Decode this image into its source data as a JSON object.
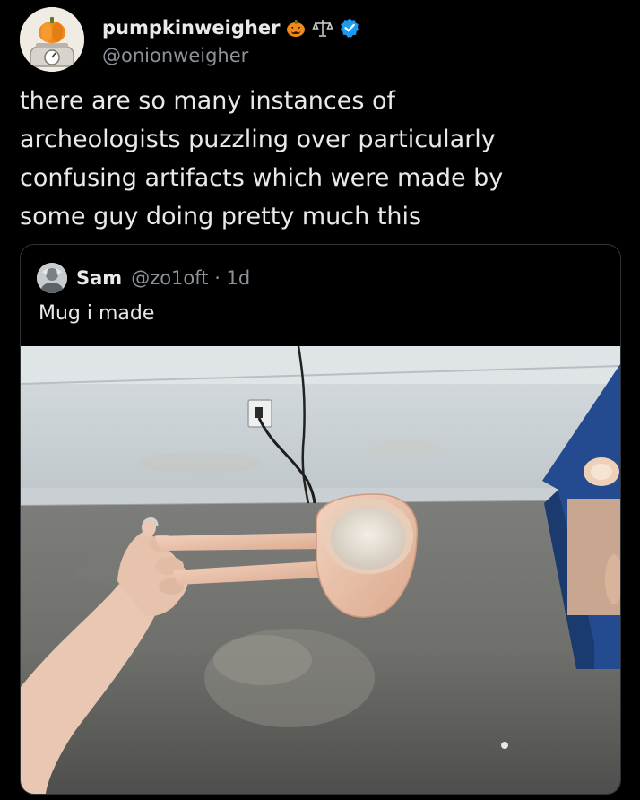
{
  "author": {
    "display_name": "pumpkinweigher",
    "handle": "@onionweigher",
    "badges": [
      "jack-o-lantern-icon",
      "scales-icon",
      "verified-badge-icon"
    ]
  },
  "post": {
    "text": "there are so many instances of\narcheologists puzzling over particularly\nconfusing artifacts which were made by\nsome guy doing pretty much this"
  },
  "quoted": {
    "name": "Sam",
    "handle": "@zo1oft",
    "separator": "·",
    "time": "1d",
    "meta": "@zo1oft · 1d",
    "text": "Mug i made"
  },
  "colors": {
    "background": "#000000",
    "text_primary": "#e7e9ea",
    "text_secondary": "#8b9298",
    "verified_blue": "#1d9bf0",
    "border": "#2f3336"
  }
}
